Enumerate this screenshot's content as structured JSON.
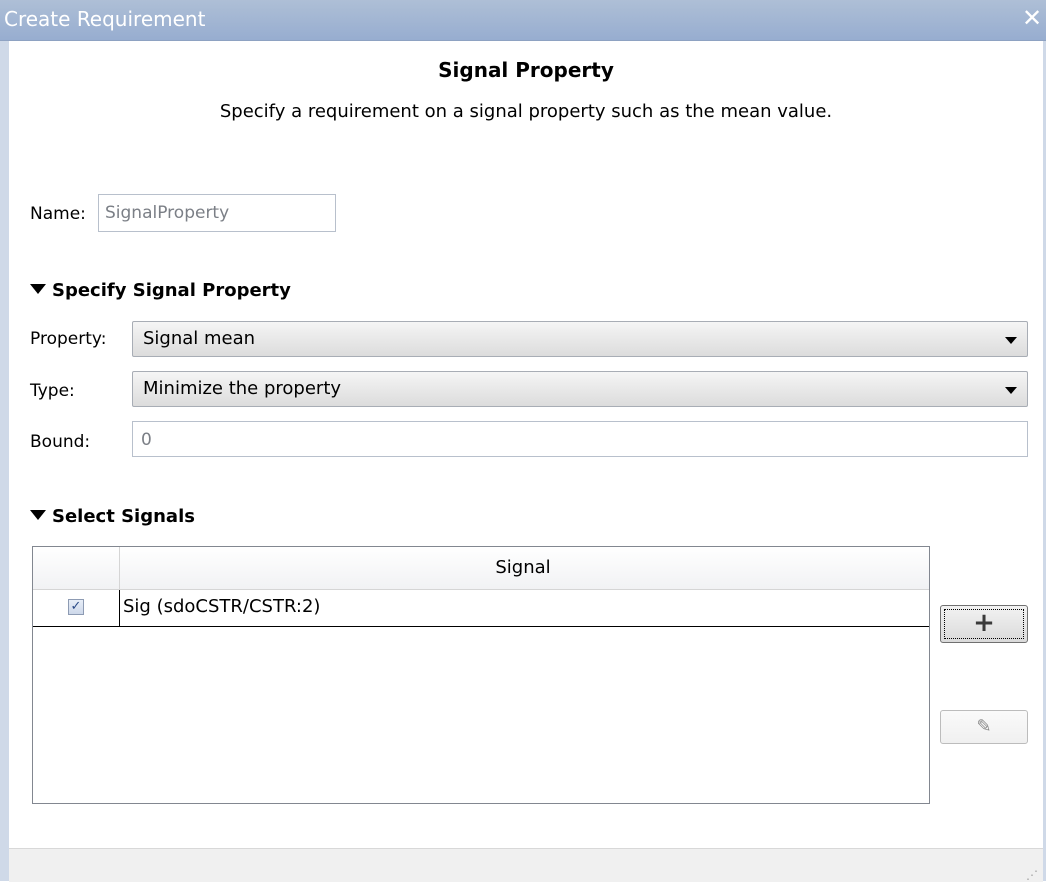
{
  "window": {
    "title": "Create Requirement",
    "close_glyph": "✕"
  },
  "header": {
    "title": "Signal Property",
    "description": "Specify a requirement on a signal property such as the mean value."
  },
  "name": {
    "label": "Name:",
    "value": "SignalProperty"
  },
  "specify_section": {
    "title": "Specify Signal Property",
    "property": {
      "label": "Property:",
      "value": "Signal mean"
    },
    "type": {
      "label": "Type:",
      "value": "Minimize the property"
    },
    "bound": {
      "label": "Bound:",
      "value": "0"
    }
  },
  "signals_section": {
    "title": "Select Signals",
    "table": {
      "columns": [
        "",
        "Signal"
      ],
      "rows": [
        {
          "checked": true,
          "signal": "Sig (sdoCSTR/CSTR:2)"
        }
      ]
    },
    "add_icon": "plus-icon",
    "edit_icon": "pencil-icon"
  },
  "colors": {
    "titlebar": "#a4b7d4",
    "frame": "#cfd9e8"
  }
}
